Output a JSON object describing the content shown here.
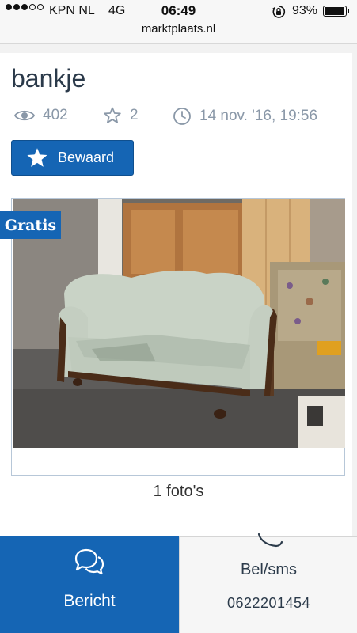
{
  "status_bar": {
    "carrier": "KPN NL",
    "network": "4G",
    "time": "06:49",
    "battery": "93%",
    "signal_bars_filled": 3,
    "signal_bars_total": 5
  },
  "browser": {
    "url": "marktplaats.nl"
  },
  "listing": {
    "title": "bankje",
    "views": "402",
    "favorites": "2",
    "date": "14 nov. '16, 19:56",
    "save_label": "Bewaard",
    "badge": "Gratis",
    "photo_count": "1 foto's"
  },
  "actions": {
    "message_label": "Bericht",
    "call_label": "Bel/sms",
    "phone": "0622201454"
  },
  "colors": {
    "brand_blue": "#1565b4",
    "meta_gray": "#8a98a8"
  },
  "icons": [
    "eye-icon",
    "star-outline-icon",
    "clock-icon",
    "star-icon",
    "chat-bubbles-icon",
    "phone-icon",
    "rotation-lock-icon",
    "battery-icon"
  ]
}
